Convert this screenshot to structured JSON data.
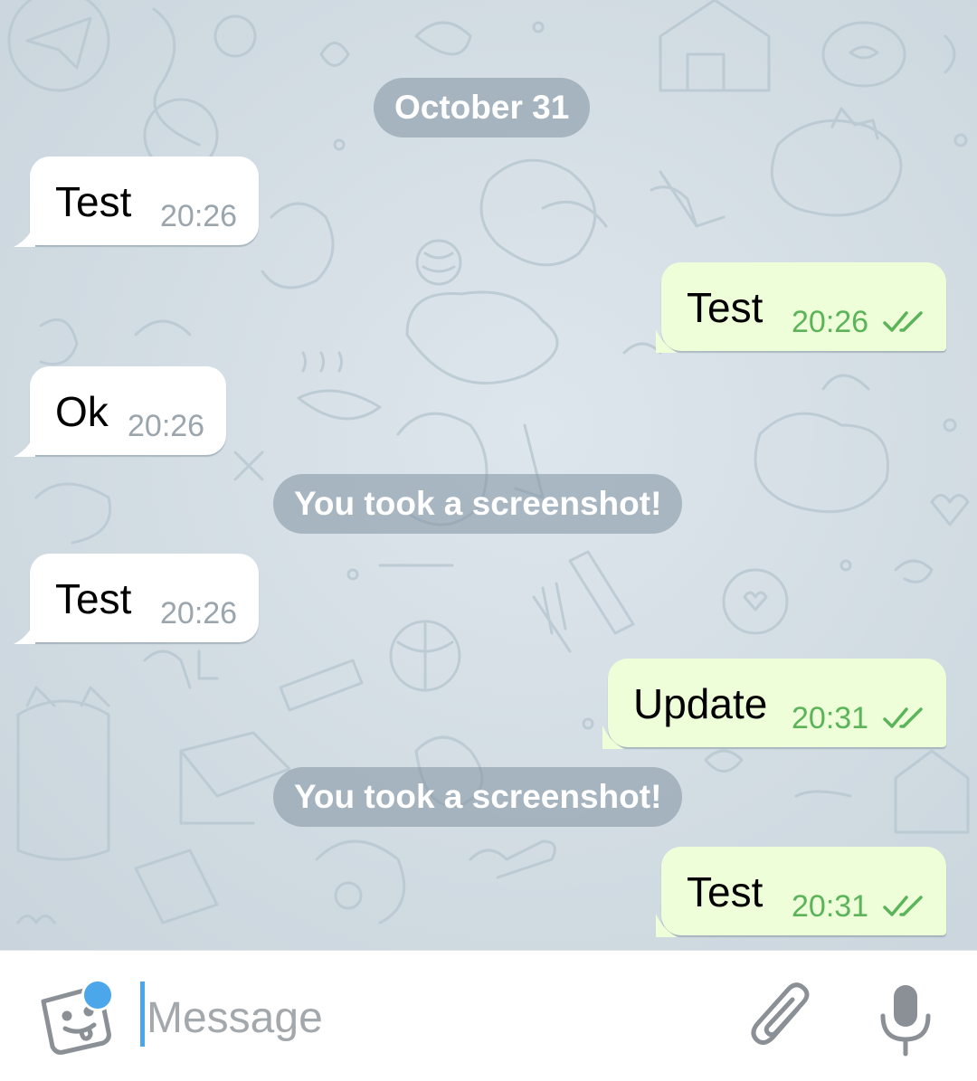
{
  "colors": {
    "wallpaper": "#d3dde4",
    "incoming_bubble": "#ffffff",
    "outgoing_bubble": "#eefed9",
    "outgoing_time": "#5cb45a",
    "incoming_time": "#9aa5ad",
    "service_pill": "#8092a0",
    "accent": "#4ba6ea"
  },
  "chat": {
    "date_separator": "October 31",
    "messages": [
      {
        "direction": "in",
        "text": "Test",
        "time": "20:26"
      },
      {
        "direction": "out",
        "text": "Test",
        "time": "20:26",
        "status": "double-check-icon"
      },
      {
        "direction": "in",
        "text": "Ok",
        "time": "20:26"
      },
      {
        "direction": "service",
        "text": "You took a screenshot!"
      },
      {
        "direction": "in",
        "text": "Test",
        "time": "20:26"
      },
      {
        "direction": "out",
        "text": "Update",
        "time": "20:31",
        "status": "double-check-icon"
      },
      {
        "direction": "service",
        "text": "You took a screenshot!"
      },
      {
        "direction": "out",
        "text": "Test",
        "time": "20:31",
        "status": "double-check-icon"
      }
    ]
  },
  "input_bar": {
    "placeholder": "Message",
    "sticker_icon": "sticker-face-icon",
    "attach_icon": "paperclip-icon",
    "mic_icon": "microphone-icon"
  }
}
